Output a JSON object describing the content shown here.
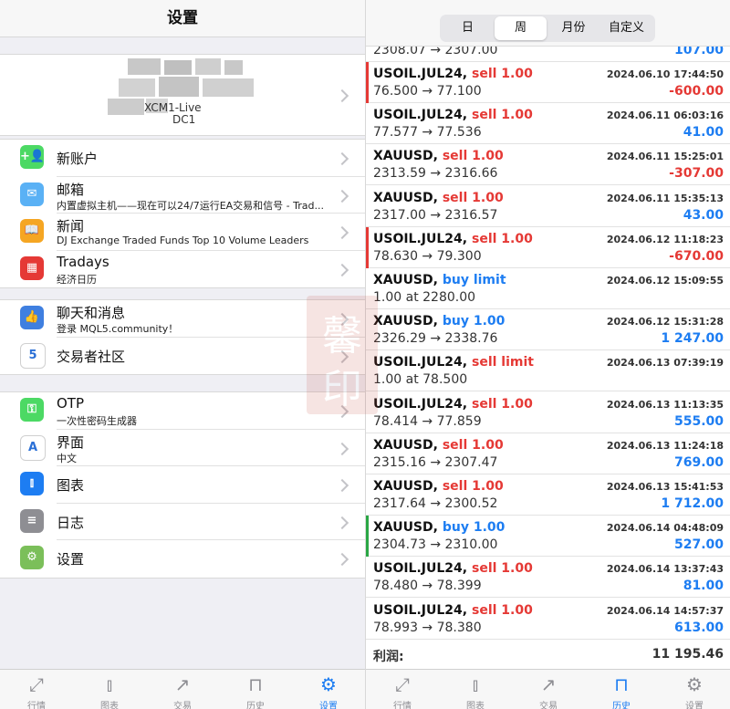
{
  "left": {
    "header_title": "设置",
    "account": {
      "name": "XCM1-Live",
      "server": "DC1"
    },
    "groups": [
      {
        "items": [
          {
            "id": "new-account",
            "icon": "add-user-icon",
            "color": "#4cd964",
            "title": "新账户",
            "subtitle": ""
          },
          {
            "id": "mailbox",
            "icon": "mail-icon",
            "color": "#5ab1f5",
            "title": "邮箱",
            "subtitle": "内置虚拟主机——现在可以24/7运行EA交易和信号 - Trad..."
          },
          {
            "id": "news",
            "icon": "book-icon",
            "color": "#f5a623",
            "title": "新闻",
            "subtitle": "DJ Exchange Traded Funds Top 10 Volume Leaders"
          },
          {
            "id": "tradays",
            "icon": "calendar-icon",
            "color": "#e53935",
            "title": "Tradays",
            "subtitle": "经济日历"
          }
        ]
      },
      {
        "items": [
          {
            "id": "chat",
            "icon": "chat-icon",
            "color": "#3f7fe0",
            "title": "聊天和消息",
            "subtitle": "登录 MQL5.community！"
          },
          {
            "id": "community",
            "icon": "mql5-icon",
            "color": "#ffffff",
            "title": "交易者社区",
            "subtitle": ""
          }
        ]
      },
      {
        "items": [
          {
            "id": "otp",
            "icon": "otp-icon",
            "color": "#4cd964",
            "title": "OTP",
            "subtitle": "一次性密码生成器"
          },
          {
            "id": "interface",
            "icon": "language-icon",
            "color": "#ffffff",
            "title": "界面",
            "subtitle": "中文"
          },
          {
            "id": "charts",
            "icon": "candlestick-icon",
            "color": "#1d7df2",
            "title": "图表",
            "subtitle": ""
          },
          {
            "id": "journal",
            "icon": "journal-icon",
            "color": "#8e8e93",
            "title": "日志",
            "subtitle": ""
          },
          {
            "id": "settings",
            "icon": "settings-icon",
            "color": "#7bbf5a",
            "title": "设置",
            "subtitle": ""
          }
        ]
      }
    ]
  },
  "tabs": [
    {
      "id": "quotes",
      "icon": "quotes-icon",
      "label": "行情"
    },
    {
      "id": "chart",
      "icon": "chart-icon",
      "label": "图表"
    },
    {
      "id": "trade",
      "icon": "trade-icon",
      "label": "交易"
    },
    {
      "id": "history",
      "icon": "history-icon",
      "label": "历史"
    },
    {
      "id": "settings",
      "icon": "gear-icon",
      "label": "设置"
    }
  ],
  "left_active_tab": "settings",
  "right_active_tab": "history",
  "right": {
    "segments": [
      "日",
      "周",
      "月份",
      "自定义"
    ],
    "active_segment": "周",
    "partial_top": {
      "price": "2308.07 → 2307.00",
      "profit": "107.00"
    },
    "deals": [
      {
        "symbol": "USOIL.JUL24,",
        "action": "sell 1.00",
        "side": "sell",
        "time": "2024.06.10 17:44:50",
        "price": "76.500 → 77.100",
        "profit": "-600.00",
        "mark": "#e53935"
      },
      {
        "symbol": "USOIL.JUL24,",
        "action": "sell 1.00",
        "side": "sell",
        "time": "2024.06.11 06:03:16",
        "price": "77.577 → 77.536",
        "profit": "41.00",
        "mark": ""
      },
      {
        "symbol": "XAUUSD,",
        "action": "sell 1.00",
        "side": "sell",
        "time": "2024.06.11 15:25:01",
        "price": "2313.59 → 2316.66",
        "profit": "-307.00",
        "mark": ""
      },
      {
        "symbol": "XAUUSD,",
        "action": "sell 1.00",
        "side": "sell",
        "time": "2024.06.11 15:35:13",
        "price": "2317.00 → 2316.57",
        "profit": "43.00",
        "mark": ""
      },
      {
        "symbol": "USOIL.JUL24,",
        "action": "sell 1.00",
        "side": "sell",
        "time": "2024.06.12 11:18:23",
        "price": "78.630 → 79.300",
        "profit": "-670.00",
        "mark": "#e53935"
      },
      {
        "symbol": "XAUUSD,",
        "action": "buy limit",
        "side": "buy",
        "time": "2024.06.12 15:09:55",
        "price": "1.00 at 2280.00",
        "profit": "",
        "mark": ""
      },
      {
        "symbol": "XAUUSD,",
        "action": "buy 1.00",
        "side": "buy",
        "time": "2024.06.12 15:31:28",
        "price": "2326.29 → 2338.76",
        "profit": "1 247.00",
        "mark": ""
      },
      {
        "symbol": "USOIL.JUL24,",
        "action": "sell limit",
        "side": "sell",
        "time": "2024.06.13 07:39:19",
        "price": "1.00 at 78.500",
        "profit": "",
        "mark": ""
      },
      {
        "symbol": "USOIL.JUL24,",
        "action": "sell 1.00",
        "side": "sell",
        "time": "2024.06.13 11:13:35",
        "price": "78.414 → 77.859",
        "profit": "555.00",
        "mark": ""
      },
      {
        "symbol": "XAUUSD,",
        "action": "sell 1.00",
        "side": "sell",
        "time": "2024.06.13 11:24:18",
        "price": "2315.16 → 2307.47",
        "profit": "769.00",
        "mark": ""
      },
      {
        "symbol": "XAUUSD,",
        "action": "sell 1.00",
        "side": "sell",
        "time": "2024.06.13 15:41:53",
        "price": "2317.64 → 2300.52",
        "profit": "1 712.00",
        "mark": ""
      },
      {
        "symbol": "XAUUSD,",
        "action": "buy 1.00",
        "side": "buy",
        "time": "2024.06.14 04:48:09",
        "price": "2304.73 → 2310.00",
        "profit": "527.00",
        "mark": "#2aa745"
      },
      {
        "symbol": "USOIL.JUL24,",
        "action": "sell 1.00",
        "side": "sell",
        "time": "2024.06.14 13:37:43",
        "price": "78.480 → 78.399",
        "profit": "81.00",
        "mark": ""
      },
      {
        "symbol": "USOIL.JUL24,",
        "action": "sell 1.00",
        "side": "sell",
        "time": "2024.06.14 14:57:37",
        "price": "78.993 → 78.380",
        "profit": "613.00",
        "mark": ""
      }
    ],
    "summary": {
      "label": "利润:",
      "value": "11 195.46"
    }
  },
  "watermark": {
    "chars": [
      "馨",
      "印"
    ]
  }
}
